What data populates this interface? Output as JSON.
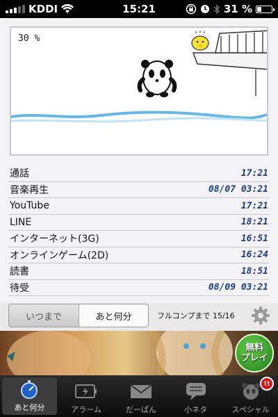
{
  "status_bar": {
    "carrier": "KDDI",
    "time": "15:21",
    "battery": "31 %",
    "battery_level": 0.31
  },
  "game": {
    "progress": "30 %"
  },
  "usage_list": [
    {
      "label": "通話",
      "time": "17:21"
    },
    {
      "label": "音楽再生",
      "time": "08/07 03:21"
    },
    {
      "label": "YouTube",
      "time": "17:21"
    },
    {
      "label": "LINE",
      "time": "18:21"
    },
    {
      "label": "インターネット(3G)",
      "time": "16:51"
    },
    {
      "label": "オンラインゲーム(2D)",
      "time": "16:24"
    },
    {
      "label": "読書",
      "time": "18:51"
    },
    {
      "label": "待受",
      "time": "08/09 03:21"
    }
  ],
  "controls": {
    "until_label": "いつまで",
    "remaining_label": "あと何分",
    "complete_text": "フルコンプまで 15/16"
  },
  "ad": {
    "badge_line1": "無料",
    "badge_line2": "プレイ"
  },
  "tabbar": {
    "tabs": [
      {
        "label": "あと何分",
        "icon": "stopwatch-icon"
      },
      {
        "label": "アラーム",
        "icon": "battery-icon"
      },
      {
        "label": "だーぱん",
        "icon": "mail-icon"
      },
      {
        "label": "小ネタ",
        "icon": "chat-bubble-icon"
      },
      {
        "label": "スペシャル",
        "icon": "panda-icon"
      }
    ],
    "special_badge": "!!"
  }
}
